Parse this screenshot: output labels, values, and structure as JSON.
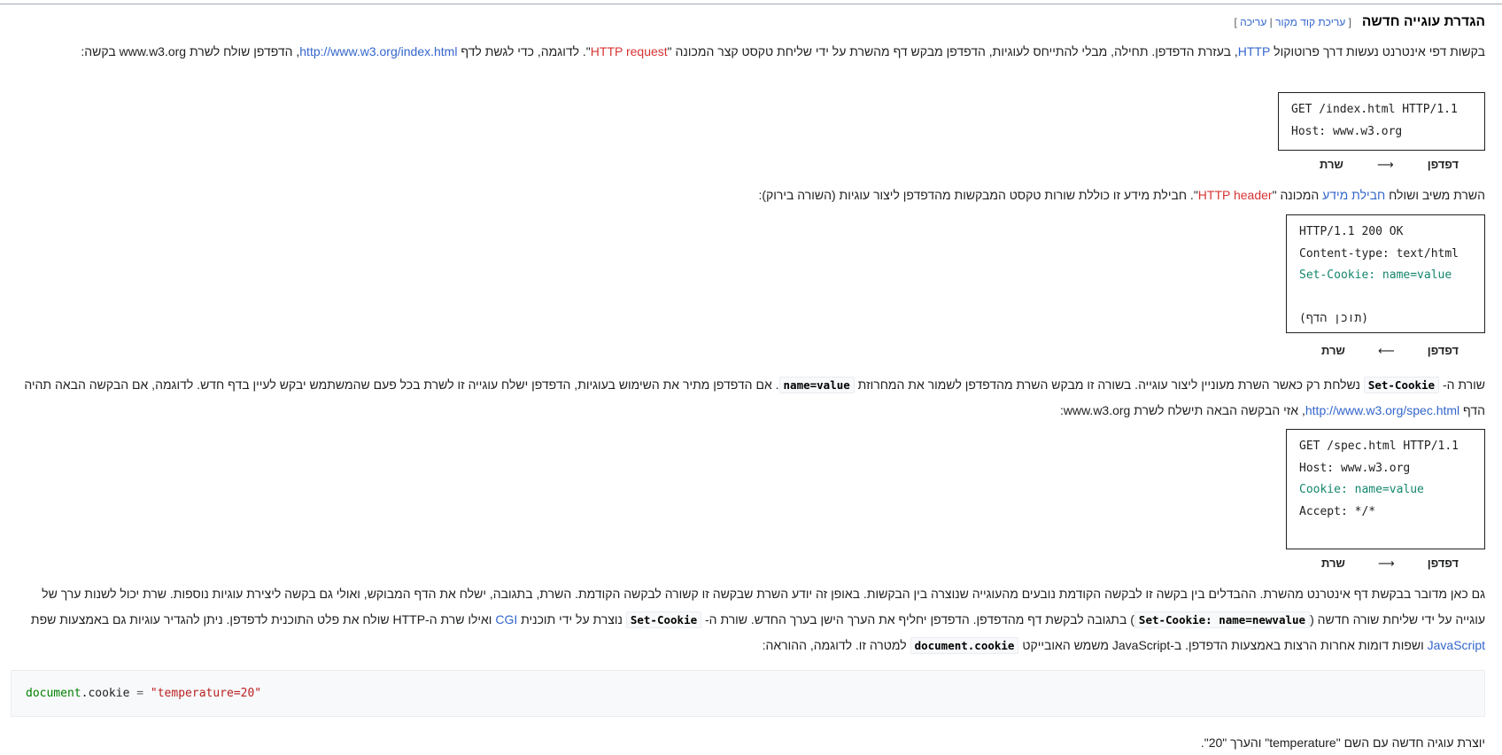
{
  "section": {
    "title": "הגדרת עוגייה חדשה",
    "edit_open": "[",
    "edit_source": "עריכת קוד מקור",
    "edit_sep": "|",
    "edit": "עריכה",
    "edit_close": "]"
  },
  "para1": {
    "t1": "בקשות דפי אינטרנט נעשות דרך פרוטוקול ",
    "link_http": "HTTP",
    "t2": ", בעזרת הדפדפן. תחילה, מבלי להתייחס לעוגיות, הדפדפן מבקש דף מהשרת על ידי שליחת טקסט קצר המכונה \"",
    "link_request": "HTTP request",
    "t3": "\". לדוגמה, כדי לגשת לדף ",
    "link_url": "http://www.w3.org/index.html",
    "t4": ", הדפדפן שולח לשרת www.w3.org בקשה:"
  },
  "box1": {
    "lines": [
      "GET /index.html HTTP/1.1",
      "Host: www.w3.org"
    ]
  },
  "cap1": {
    "browser": "דפדפן",
    "arrow": "⟶",
    "server": "שרת"
  },
  "para2": {
    "t1": "השרת משיב ושולח ",
    "link_packet": "חבילת מידע",
    "t2": " המכונה \"",
    "link_header": "HTTP header",
    "t3": "\". חבילת מידע זו כוללת שורות טקסט המבקשות מהדפדפן ליצור עוגיות (השורה בירוק):"
  },
  "box2": {
    "line1": "HTTP/1.1 200 OK",
    "line2": "Content-type: text/html",
    "line3": "Set-Cookie: name=value",
    "line5": "(תוכן הדף)"
  },
  "cap2": {
    "browser": "דפדפן",
    "arrow": "⟵",
    "server": "שרת"
  },
  "para3": {
    "t1": "שורת ה- ",
    "code1": "Set-Cookie",
    "t2": " נשלחת רק כאשר השרת מעוניין ליצור עוגייה. בשורה זו מבקש השרת מהדפדפן לשמור את המחרוזת ",
    "code2": "name=value",
    "t3": ". אם הדפדפן מתיר את השימוש בעוגיות, הדפדפן ישלח עוגייה זו לשרת בכל פעם שהמשתמש יבקש לעיין בדף חדש. לדוגמה, אם הבקשה הבאה תהיה הדף ",
    "link_spec": "http://www.w3.org/spec.html",
    "t4": ", אזי הבקשה הבאה תישלח לשרת www.w3.org:"
  },
  "box3": {
    "line1": "GET /spec.html HTTP/1.1",
    "line2": "Host: www.w3.org",
    "line3": "Cookie: name=value",
    "line4": "Accept: */*"
  },
  "cap3": {
    "browser": "דפדפן",
    "arrow": "⟶",
    "server": "שרת"
  },
  "para4": {
    "t1": "גם כאן מדובר בבקשת דף אינטרנט מהשרת. ההבדלים בין בקשה זו לבקשה הקודמת נובעים מהעוגייה שנוצרה בין הבקשות. באופן זה יודע השרת שבקשה זו קשורה לבקשה הקודמת. השרת, בתגובה, ישלח את הדף המבוקש, ואולי גם בקשה ליצירת עוגיות נוספות. שרת יכול לשנות ערך של עוגייה על ידי שליחת שורה חדשה (",
    "code1": "Set-Cookie: name=newvalue",
    "t2": ") בתגובה לבקשת דף מהדפדפן. הדפדפן יחליף את הערך הישן בערך החדש. שורת ה- ",
    "code2": "Set-Cookie",
    "t3": " נוצרת על ידי תוכנית ",
    "link_cgi": "CGI",
    "t4": " ואילו שרת ה-HTTP שולח את פלט התוכנית לדפדפן. ניתן להגדיר עוגיות גם באמצעות שפת ",
    "link_js": "JavaScript",
    "t5": " ושפות דומות אחרות הרצות באמצעות הדפדפן. ב-JavaScript משמש האובייקט ",
    "code3": "document.cookie",
    "t6": " למטרה זו. לדוגמה, ההוראה:"
  },
  "code_example": {
    "obj": "document",
    "dot_prop": ".cookie",
    "op": " = ",
    "str": "\"temperature=20\""
  },
  "para5": {
    "text": "יוצרת עוגיה חדשה עם השם \"temperature\" והערך \"20\"."
  },
  "colors": {
    "link": "#3366cc",
    "redlink": "#d73333",
    "green": "#14866d"
  }
}
